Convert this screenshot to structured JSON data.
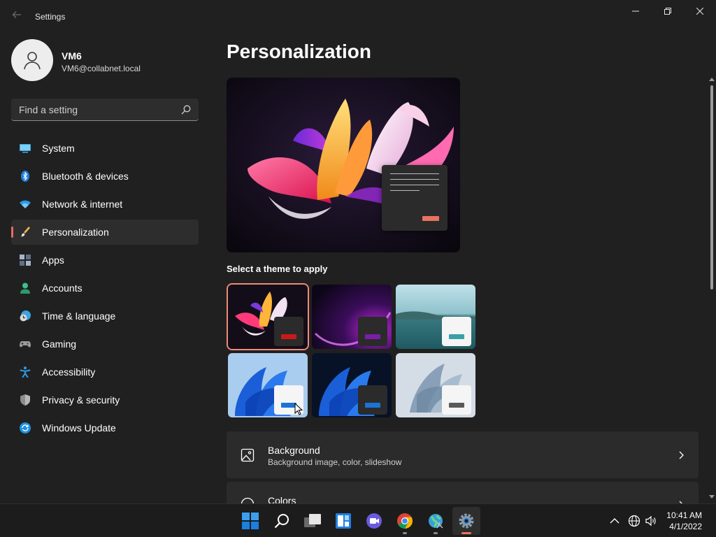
{
  "window": {
    "title": "Settings",
    "back_icon": "back-arrow-icon",
    "controls": [
      "minimize-icon",
      "restore-icon",
      "close-icon"
    ]
  },
  "profile": {
    "name": "VM6",
    "email": "VM6@collabnet.local",
    "avatar_icon": "person-icon"
  },
  "search": {
    "placeholder": "Find a setting",
    "icon": "search-icon"
  },
  "sidebar": {
    "accent": "#e86a6a",
    "selected_index": 3,
    "items": [
      {
        "label": "System",
        "icon": "system-icon"
      },
      {
        "label": "Bluetooth & devices",
        "icon": "bluetooth-icon"
      },
      {
        "label": "Network & internet",
        "icon": "wifi-icon"
      },
      {
        "label": "Personalization",
        "icon": "brush-icon"
      },
      {
        "label": "Apps",
        "icon": "apps-icon"
      },
      {
        "label": "Accounts",
        "icon": "accounts-icon"
      },
      {
        "label": "Time & language",
        "icon": "clock-globe-icon"
      },
      {
        "label": "Gaming",
        "icon": "gamepad-icon"
      },
      {
        "label": "Accessibility",
        "icon": "accessibility-icon"
      },
      {
        "label": "Privacy & security",
        "icon": "shield-icon"
      },
      {
        "label": "Windows Update",
        "icon": "update-icon"
      }
    ]
  },
  "main": {
    "title": "Personalization",
    "themes_label": "Select a theme to apply",
    "themes": [
      {
        "name": "glow-dark",
        "selected": true,
        "bar_color": "#c81a1a"
      },
      {
        "name": "purple-flow",
        "selected": false,
        "bar_color": "#7a1ea8"
      },
      {
        "name": "lake",
        "selected": false,
        "bar_color": "#3a9fa8"
      },
      {
        "name": "bloom-light",
        "selected": false,
        "bar_color": "#1a74d6"
      },
      {
        "name": "bloom-dark",
        "selected": false,
        "bar_color": "#1a74d6"
      },
      {
        "name": "captured-motion",
        "selected": false,
        "bar_color": "#5a5a5a"
      }
    ],
    "cards": [
      {
        "title": "Background",
        "subtitle": "Background image, color, slideshow",
        "icon": "image-icon"
      },
      {
        "title": "Colors",
        "subtitle": "",
        "icon": "palette-icon"
      }
    ]
  },
  "taskbar": {
    "apps": [
      {
        "name": "start",
        "icon": "windows-logo-icon"
      },
      {
        "name": "search",
        "icon": "search-icon"
      },
      {
        "name": "task-view",
        "icon": "task-view-icon"
      },
      {
        "name": "widgets",
        "icon": "widgets-icon"
      },
      {
        "name": "chat",
        "icon": "teams-chat-icon"
      },
      {
        "name": "chrome",
        "icon": "chrome-icon"
      },
      {
        "name": "network-app",
        "icon": "globe-app-icon"
      },
      {
        "name": "settings",
        "icon": "settings-gear-icon"
      }
    ],
    "tray": [
      "chevron-up-icon",
      "network-globe-icon",
      "speaker-icon"
    ],
    "time": "10:41 AM",
    "date": "4/1/2022"
  }
}
